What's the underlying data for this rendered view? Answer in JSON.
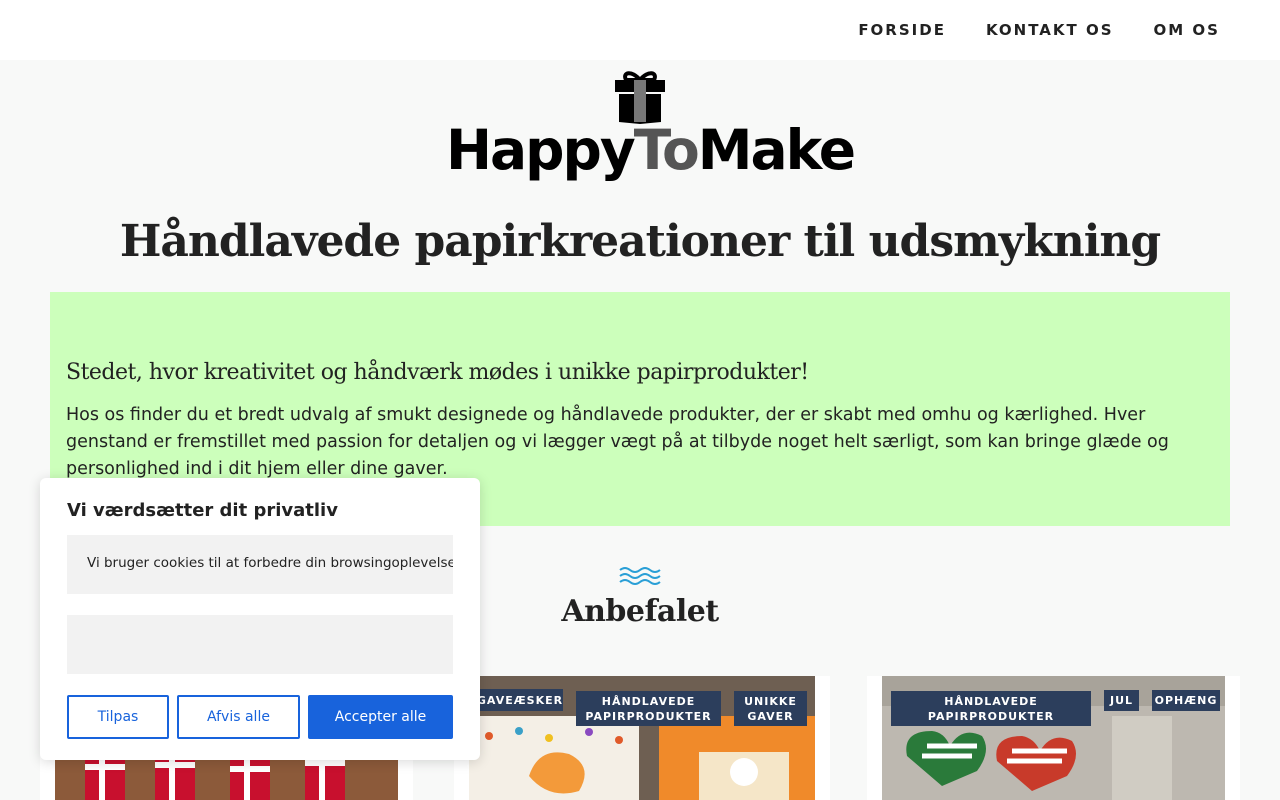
{
  "nav": {
    "items": [
      "FORSIDE",
      "KONTAKT OS",
      "OM OS"
    ]
  },
  "logo": {
    "part1": "Happy",
    "part2": "To",
    "part3": "Make"
  },
  "site_title": "Håndlavede papirkreationer til udsmykning",
  "hero": {
    "heading": "Stedet, hvor kreativitet og håndværk mødes i unikke papirprodukter!",
    "body": "Hos os finder du et bredt udvalg af smukt designede og håndlavede produkter, der er skabt med omhu og kærlighed. Hver genstand er fremstillet med passion for detaljen og vi lægger vægt på at tilbyde noget helt særligt, som kan bringe glæde og personlighed ind i dit hjem eller dine gaver."
  },
  "section": {
    "title": "Anbefalet"
  },
  "cards": [
    {
      "tags": []
    },
    {
      "tags": [
        "GAVEÆSKER",
        "HÅNDLAVEDE PAPIRPRODUKTER",
        "UNIKKE GAVER"
      ]
    },
    {
      "tags": [
        "HÅNDLAVEDE PAPIRPRODUKTER",
        "JUL",
        "OPHÆNG"
      ]
    }
  ],
  "cookie": {
    "title": "Vi værdsætter dit privatliv",
    "message": "Vi bruger cookies til at forbedre din browsingoplevelse, vis",
    "buttons": {
      "customize": "Tilpas",
      "reject": "Afvis alle",
      "accept": "Accepter alle"
    }
  },
  "colors": {
    "hero_bg": "#ccffbb",
    "tag_bg": "#2c3e5c",
    "cookie_accent": "#1863dc",
    "waves": "#2a9fd6"
  }
}
